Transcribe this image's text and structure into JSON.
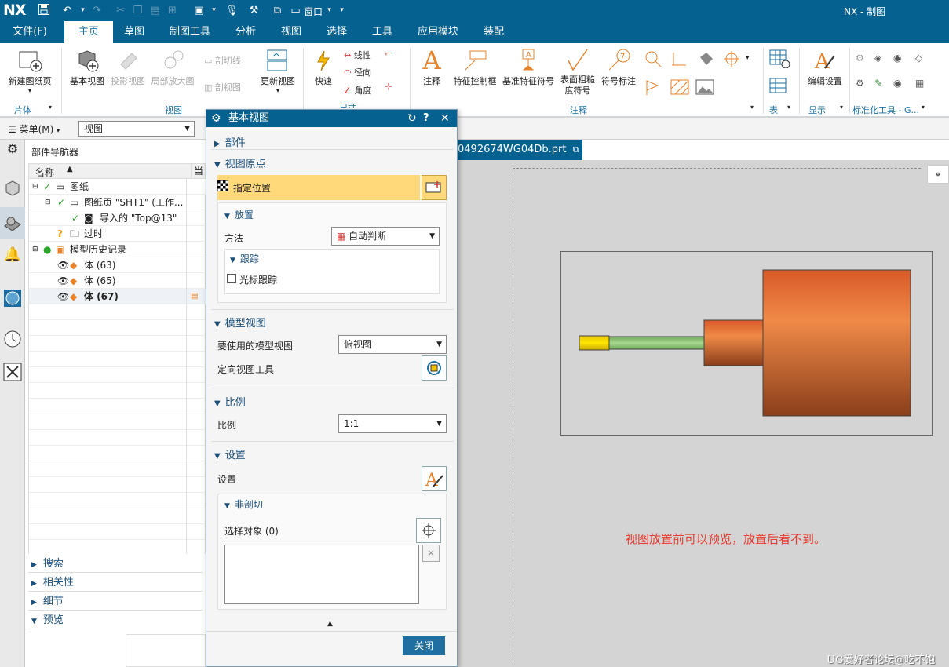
{
  "app": {
    "logo": "NX",
    "title": "NX - 制图",
    "window_menu": "窗口"
  },
  "menus": [
    "文件(F)",
    "主页",
    "草图",
    "制图工具",
    "分析",
    "视图",
    "选择",
    "工具",
    "应用模块",
    "装配"
  ],
  "ribbon": {
    "new_sheet": "新建图纸页",
    "base_view": "基本视图",
    "projected_view": "投影视图",
    "detail_view": "局部放大图",
    "section_line": "剖切线",
    "section_view": "剖视图",
    "update_view": "更新视图",
    "quick": "快速",
    "linear": "线性",
    "radial": "径向",
    "angle": "角度",
    "note": "注释",
    "fcf": "特征控制框",
    "datum": "基准特征符号",
    "surface_finish": "表面粗糙度符号",
    "symbol_note": "符号标注",
    "edit_settings": "编辑设置",
    "groups": {
      "sheet": "片体",
      "view": "视图",
      "dimension": "尺寸",
      "annotation": "注释",
      "table": "表",
      "display": "显示",
      "std": "标准化工具 - G..."
    }
  },
  "toolbar2": {
    "menu": "菜单(M)",
    "filter": "视图"
  },
  "navigator": {
    "title": "部件导航器",
    "col_name": "名称",
    "col_current": "当",
    "rows": [
      {
        "label": "图纸",
        "indent": 0
      },
      {
        "label": "图纸页 \"SHT1\" (工作...",
        "indent": 1
      },
      {
        "label": "导入的 \"Top@13\"",
        "indent": 2
      },
      {
        "label": "过时",
        "indent": 1
      },
      {
        "label": "模型历史记录",
        "indent": 0
      },
      {
        "label": "体 (63)",
        "indent": 1
      },
      {
        "label": "体 (65)",
        "indent": 1
      },
      {
        "label": "体 (67)",
        "indent": 1
      }
    ],
    "sections": [
      "搜索",
      "相关性",
      "细节",
      "预览"
    ]
  },
  "dialog": {
    "title": "基本视图",
    "part": "部件",
    "view_origin": "视图原点",
    "specify_location": "指定位置",
    "placement": "放置",
    "method_label": "方法",
    "method_value": "自动判断",
    "tracking": "跟踪",
    "cursor_tracking": "光标跟踪",
    "model_view": "模型视图",
    "model_view_label": "要使用的模型视图",
    "model_view_value": "俯视图",
    "orient_tool": "定向视图工具",
    "scale": "比例",
    "scale_label": "比例",
    "scale_value": "1:1",
    "settings": "设置",
    "settings_label": "设置",
    "non_section": "非剖切",
    "select_objects": "选择对象 (0)",
    "close": "关闭"
  },
  "file_tab": "0492674WG04Db.prt",
  "annotation": "视图放置前可以预览，放置后看不到。",
  "watermark": "UG爱好者论坛@吃不饱",
  "colors": {
    "brand": "#05618f",
    "shaft_yellow": "#f2d300",
    "shaft_green": "#8fc47a",
    "body_orange": "#e8733a",
    "annotation_red": "#e83a2e"
  }
}
